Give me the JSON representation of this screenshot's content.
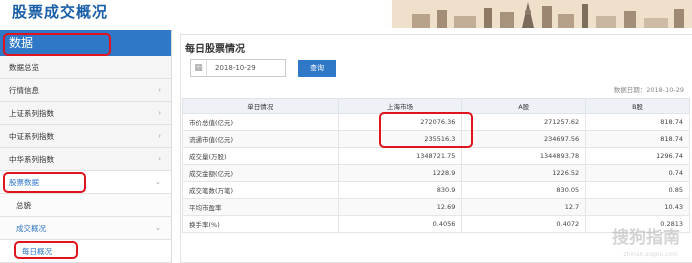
{
  "banner": {
    "title": "股票成交概况"
  },
  "sidebar": {
    "header": "数据",
    "items": [
      {
        "label": "数据总览",
        "arrow": ""
      },
      {
        "label": "行情信息",
        "arrow": "›"
      },
      {
        "label": "上证系列指数",
        "arrow": "›"
      },
      {
        "label": "中证系列指数",
        "arrow": "›"
      },
      {
        "label": "中华系列指数",
        "arrow": "›"
      },
      {
        "label": "股票数据",
        "arrow": "⌄"
      },
      {
        "label": "总貌",
        "arrow": ""
      },
      {
        "label": "成交概况",
        "arrow": "⌄"
      },
      {
        "label": "每日概况",
        "arrow": ""
      }
    ]
  },
  "main": {
    "title": "每日股票情况",
    "date_value": "2018-10-29",
    "query_label": "查询",
    "data_time": "数据日期：2018-10-29",
    "table": {
      "headers": [
        "单日情况",
        "上海市场",
        "A股",
        "B股"
      ],
      "rows": [
        [
          "市价总值(亿元)",
          "272076.36",
          "271257.62",
          "818.74"
        ],
        [
          "流通市值(亿元)",
          "235516.3",
          "234697.56",
          "818.74"
        ],
        [
          "成交量(万股)",
          "1348721.75",
          "1344893.78",
          "1296.74"
        ],
        [
          "成交金额(亿元)",
          "1228.9",
          "1226.52",
          "0.74"
        ],
        [
          "成交笔数(万笔)",
          "830.9",
          "830.05",
          "0.85"
        ],
        [
          "平均市盈率",
          "12.69",
          "12.7",
          "10.43"
        ],
        [
          "换手率(%)",
          "0.4056",
          "0.4072",
          "0.2813"
        ]
      ]
    }
  },
  "watermark": {
    "text": "搜狗指南",
    "sub": "zhinan.sogou.com"
  },
  "colors": {
    "accent": "#2f77c7",
    "highlight_ring": "#e0141e",
    "banner_title": "#1a5fa8"
  }
}
